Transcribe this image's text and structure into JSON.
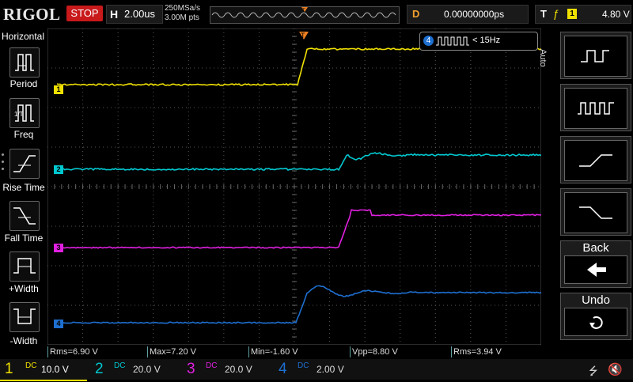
{
  "brand": "RIGOL",
  "run_state": "STOP",
  "timebase": {
    "letter": "H",
    "value": "2.00us"
  },
  "acquisition": {
    "sample_rate": "250MSa/s",
    "memory_depth": "3.00M pts"
  },
  "delay": {
    "letter": "D",
    "value": "0.00000000ps"
  },
  "trigger": {
    "letter": "T",
    "slope": "ƒ",
    "source": "1",
    "level": "4.80 V"
  },
  "left_menu": {
    "title": "Horizontal",
    "items": [
      {
        "label": "Period",
        "icon": "period-icon"
      },
      {
        "label": "Freq",
        "icon": "frequency-icon"
      },
      {
        "label": "Rise Time",
        "icon": "rise-time-icon"
      },
      {
        "label": "Fall Time",
        "icon": "fall-time-icon"
      },
      {
        "label": "+Width",
        "icon": "positive-width-icon"
      },
      {
        "label": "-Width",
        "icon": "negative-width-icon"
      }
    ]
  },
  "right_menu": {
    "mode": "Auto",
    "back_label": "Back",
    "undo_label": "Undo"
  },
  "message": {
    "channel": "4",
    "text": "< 15Hz"
  },
  "measurements": [
    {
      "text": "Rms=6.90 V"
    },
    {
      "text": "Max=7.20 V"
    },
    {
      "text": "Min=-1.60 V"
    },
    {
      "text": "Vpp=8.80 V"
    },
    {
      "text": "Rms=3.94 V"
    }
  ],
  "channels": [
    {
      "num": "1",
      "coupling": "DC",
      "scale": "10.0 V",
      "color": "#f0e000"
    },
    {
      "num": "2",
      "coupling": "DC",
      "scale": "20.0 V",
      "color": "#00c8d0"
    },
    {
      "num": "3",
      "coupling": "DC",
      "scale": "20.0 V",
      "color": "#e020e0"
    },
    {
      "num": "4",
      "coupling": "DC",
      "scale": "2.00 V",
      "color": "#1e6fd0"
    }
  ],
  "trigger_marker": "T",
  "colors": {
    "ch1": "#f0e000",
    "ch2": "#00c8d0",
    "ch3": "#e020e0",
    "ch4": "#1e6fd0",
    "trigger": "#f08020",
    "stop": "#c8191b"
  }
}
